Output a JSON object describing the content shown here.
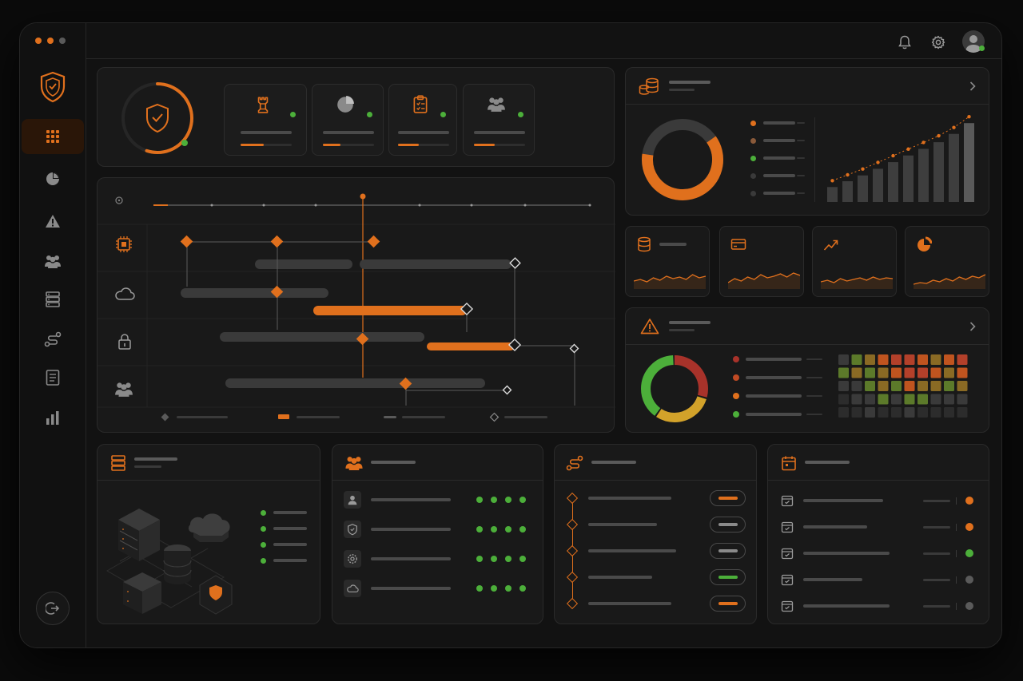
{
  "colors": {
    "accent": "#e0701d",
    "green": "#4caf3a",
    "red": "#a8322a",
    "yellow": "#d2a22a",
    "background": "#121212",
    "panel": "#191919"
  },
  "window": {
    "controls": [
      "window-dot-close",
      "window-dot-minimize",
      "window-dot-maximize"
    ]
  },
  "topbar": {
    "icons": [
      "bell-icon",
      "gear-icon",
      "avatar"
    ]
  },
  "sidebar": {
    "logo": "shield-logo-icon",
    "items": [
      {
        "icon": "grid-icon",
        "active": true
      },
      {
        "icon": "pie-chart-icon",
        "active": false
      },
      {
        "icon": "warning-icon",
        "active": false
      },
      {
        "icon": "users-icon",
        "active": false
      },
      {
        "icon": "server-icon",
        "active": false
      },
      {
        "icon": "route-icon",
        "active": false
      },
      {
        "icon": "report-icon",
        "active": false
      },
      {
        "icon": "bar-chart-icon",
        "active": false
      }
    ],
    "logout_icon": "logout-icon"
  },
  "status_overview": {
    "gauge_progress": 0.55,
    "gauge_icon": "shield-check-icon",
    "cards": [
      {
        "icon": "rook-icon",
        "progress": 0.45,
        "status": "green"
      },
      {
        "icon": "pie-icon",
        "progress": 0.35,
        "status": "green"
      },
      {
        "icon": "clipboard-icon",
        "progress": 0.4,
        "status": "green"
      },
      {
        "icon": "team-icon",
        "progress": 0.4,
        "status": "green"
      }
    ]
  },
  "timeline": {
    "rows": [
      "cpu-icon",
      "cloud-icon",
      "lock-icon",
      "users-icon"
    ],
    "legend": [
      "milestone",
      "active-task",
      "pending-task",
      "completed-milestone"
    ]
  },
  "storage_panel": {
    "icon": "database-stack-icon",
    "donut": {
      "orange": 0.62,
      "dark": 0.38
    },
    "legend_colors": [
      "#e0701d",
      "#8a5a3a",
      "#4caf3a",
      "#3a3a3a",
      "#3a3a3a"
    ],
    "bar_values": [
      18,
      25,
      32,
      40,
      48,
      56,
      64,
      72,
      82,
      95
    ]
  },
  "mini_cards": [
    {
      "icon": "database-icon"
    },
    {
      "icon": "credit-card-icon"
    },
    {
      "icon": "trend-up-icon"
    },
    {
      "icon": "pie-icon"
    }
  ],
  "alerts_panel": {
    "icon": "alert-triangle-icon",
    "donut": {
      "red": 0.3,
      "yellow": 0.3,
      "green": 0.4
    },
    "legend_colors": [
      "#a8322a",
      "#c04a24",
      "#e0701d",
      "#4caf3a"
    ],
    "heatmap": [
      [
        1,
        2,
        3,
        4,
        5,
        5,
        4,
        3,
        4,
        5
      ],
      [
        2,
        3,
        2,
        3,
        4,
        5,
        5,
        4,
        3,
        4
      ],
      [
        1,
        1,
        2,
        3,
        2,
        4,
        3,
        3,
        2,
        3
      ],
      [
        0,
        1,
        1,
        2,
        1,
        2,
        2,
        1,
        1,
        1
      ],
      [
        0,
        0,
        1,
        0,
        0,
        1,
        0,
        0,
        0,
        0
      ]
    ]
  },
  "infrastructure_panel": {
    "icon": "server-stack-icon",
    "legend_count": 4
  },
  "users_panel": {
    "icon": "team-icon",
    "rows": [
      {
        "icon": "user-icon",
        "dots": 4
      },
      {
        "icon": "shield-small-icon",
        "dots": 4
      },
      {
        "icon": "settings-icon",
        "dots": 4
      },
      {
        "icon": "cloud-small-icon",
        "dots": 4
      }
    ]
  },
  "workflow_panel": {
    "icon": "workflow-icon",
    "steps": [
      {
        "pill_color": "#e0701d"
      },
      {
        "pill_color": "#8a8a8a"
      },
      {
        "pill_color": "#8a8a8a"
      },
      {
        "pill_color": "#4caf3a"
      },
      {
        "pill_color": "#e0701d"
      }
    ]
  },
  "schedule_panel": {
    "icon": "calendar-icon",
    "rows": [
      {
        "status": "#e0701d"
      },
      {
        "status": "#e0701d"
      },
      {
        "status": "#4caf3a"
      },
      {
        "status": "#5a5a5a"
      },
      {
        "status": "#5a5a5a"
      }
    ]
  }
}
